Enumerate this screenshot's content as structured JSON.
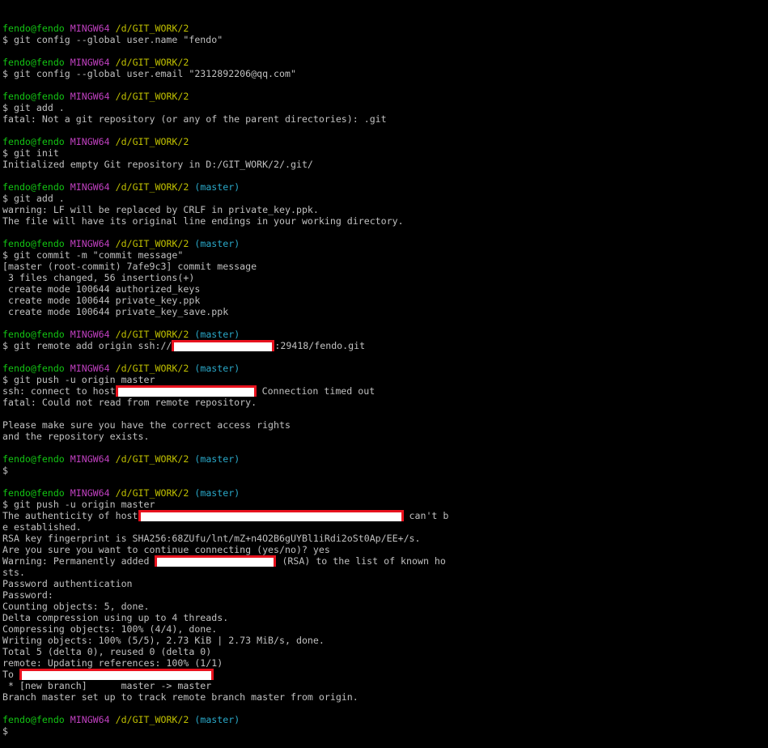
{
  "prompt": {
    "user": "fendo@fendo",
    "shell": "MINGW64",
    "path": "/d/GIT_WORK/2",
    "branch": "(master)",
    "symbol": "$"
  },
  "lines": [
    {
      "type": "prompt",
      "branch": false
    },
    {
      "type": "cmd",
      "text": "$ git config --global user.name \"fendo\""
    },
    {
      "type": "blank"
    },
    {
      "type": "prompt",
      "branch": false
    },
    {
      "type": "cmd",
      "text": "$ git config --global user.email \"2312892206@qq.com\""
    },
    {
      "type": "blank"
    },
    {
      "type": "prompt",
      "branch": false
    },
    {
      "type": "cmd",
      "text": "$ git add ."
    },
    {
      "type": "out",
      "text": "fatal: Not a git repository (or any of the parent directories): .git"
    },
    {
      "type": "blank"
    },
    {
      "type": "prompt",
      "branch": false
    },
    {
      "type": "cmd",
      "text": "$ git init"
    },
    {
      "type": "out",
      "text": "Initialized empty Git repository in D:/GIT_WORK/2/.git/"
    },
    {
      "type": "blank"
    },
    {
      "type": "prompt",
      "branch": true
    },
    {
      "type": "cmd",
      "text": "$ git add ."
    },
    {
      "type": "out",
      "text": "warning: LF will be replaced by CRLF in private_key.ppk."
    },
    {
      "type": "out",
      "text": "The file will have its original line endings in your working directory."
    },
    {
      "type": "blank"
    },
    {
      "type": "prompt",
      "branch": true
    },
    {
      "type": "cmd",
      "text": "$ git commit -m \"commit message\""
    },
    {
      "type": "out",
      "text": "[master (root-commit) 7afe9c3] commit message"
    },
    {
      "type": "out",
      "text": " 3 files changed, 56 insertions(+)"
    },
    {
      "type": "out",
      "text": " create mode 100644 authorized_keys"
    },
    {
      "type": "out",
      "text": " create mode 100644 private_key.ppk"
    },
    {
      "type": "out",
      "text": " create mode 100644 private_key_save.ppk"
    },
    {
      "type": "blank"
    },
    {
      "type": "prompt",
      "branch": true
    },
    {
      "type": "redacted",
      "before": "$ git remote add origin ssh://",
      "width": 127,
      "after": ":29418/fendo.git"
    },
    {
      "type": "blank"
    },
    {
      "type": "prompt",
      "branch": true
    },
    {
      "type": "cmd",
      "text": "$ git push -u origin master"
    },
    {
      "type": "redacted",
      "before": "ssh: connect to host",
      "width": 174,
      "after": " Connection timed out"
    },
    {
      "type": "out",
      "text": "fatal: Could not read from remote repository."
    },
    {
      "type": "blank"
    },
    {
      "type": "out",
      "text": "Please make sure you have the correct access rights"
    },
    {
      "type": "out",
      "text": "and the repository exists."
    },
    {
      "type": "blank"
    },
    {
      "type": "prompt",
      "branch": true
    },
    {
      "type": "cmd",
      "text": "$"
    },
    {
      "type": "blank"
    },
    {
      "type": "prompt",
      "branch": true
    },
    {
      "type": "cmd",
      "text": "$ git push -u origin master"
    },
    {
      "type": "redacted",
      "before": "The authenticity of host",
      "width": 328,
      "after": " can't b"
    },
    {
      "type": "out",
      "text": "e established."
    },
    {
      "type": "out",
      "text": "RSA key fingerprint is SHA256:68ZUfu/lnt/mZ+n4O2B6gUYBl1iRdi2oSt0Ap/EE+/s."
    },
    {
      "type": "out",
      "text": "Are you sure you want to continue connecting (yes/no)? yes"
    },
    {
      "type": "redacted",
      "before": "Warning: Permanently added ",
      "width": 150,
      "after": " (RSA) to the list of known ho"
    },
    {
      "type": "out",
      "text": "sts."
    },
    {
      "type": "out",
      "text": "Password authentication"
    },
    {
      "type": "out",
      "text": "Password:"
    },
    {
      "type": "out",
      "text": "Counting objects: 5, done."
    },
    {
      "type": "out",
      "text": "Delta compression using up to 4 threads."
    },
    {
      "type": "out",
      "text": "Compressing objects: 100% (4/4), done."
    },
    {
      "type": "out",
      "text": "Writing objects: 100% (5/5), 2.73 KiB | 2.73 MiB/s, done."
    },
    {
      "type": "out",
      "text": "Total 5 (delta 0), reused 0 (delta 0)"
    },
    {
      "type": "out",
      "text": "remote: Updating references: 100% (1/1)"
    },
    {
      "type": "redacted",
      "before": "To ",
      "width": 240,
      "after": ""
    },
    {
      "type": "out",
      "text": " * [new branch]      master -> master"
    },
    {
      "type": "out",
      "text": "Branch master set up to track remote branch master from origin."
    },
    {
      "type": "blank"
    },
    {
      "type": "prompt",
      "branch": true
    },
    {
      "type": "cmd",
      "text": "$"
    }
  ],
  "colors": {
    "background": "#000000",
    "text": "#c0c0c0",
    "user": "#13c413",
    "shell": "#c040c0",
    "path": "#c0c000",
    "branch": "#2aa8c8",
    "redaction_border": "#e8121e",
    "redaction_fill": "#ffffff"
  }
}
